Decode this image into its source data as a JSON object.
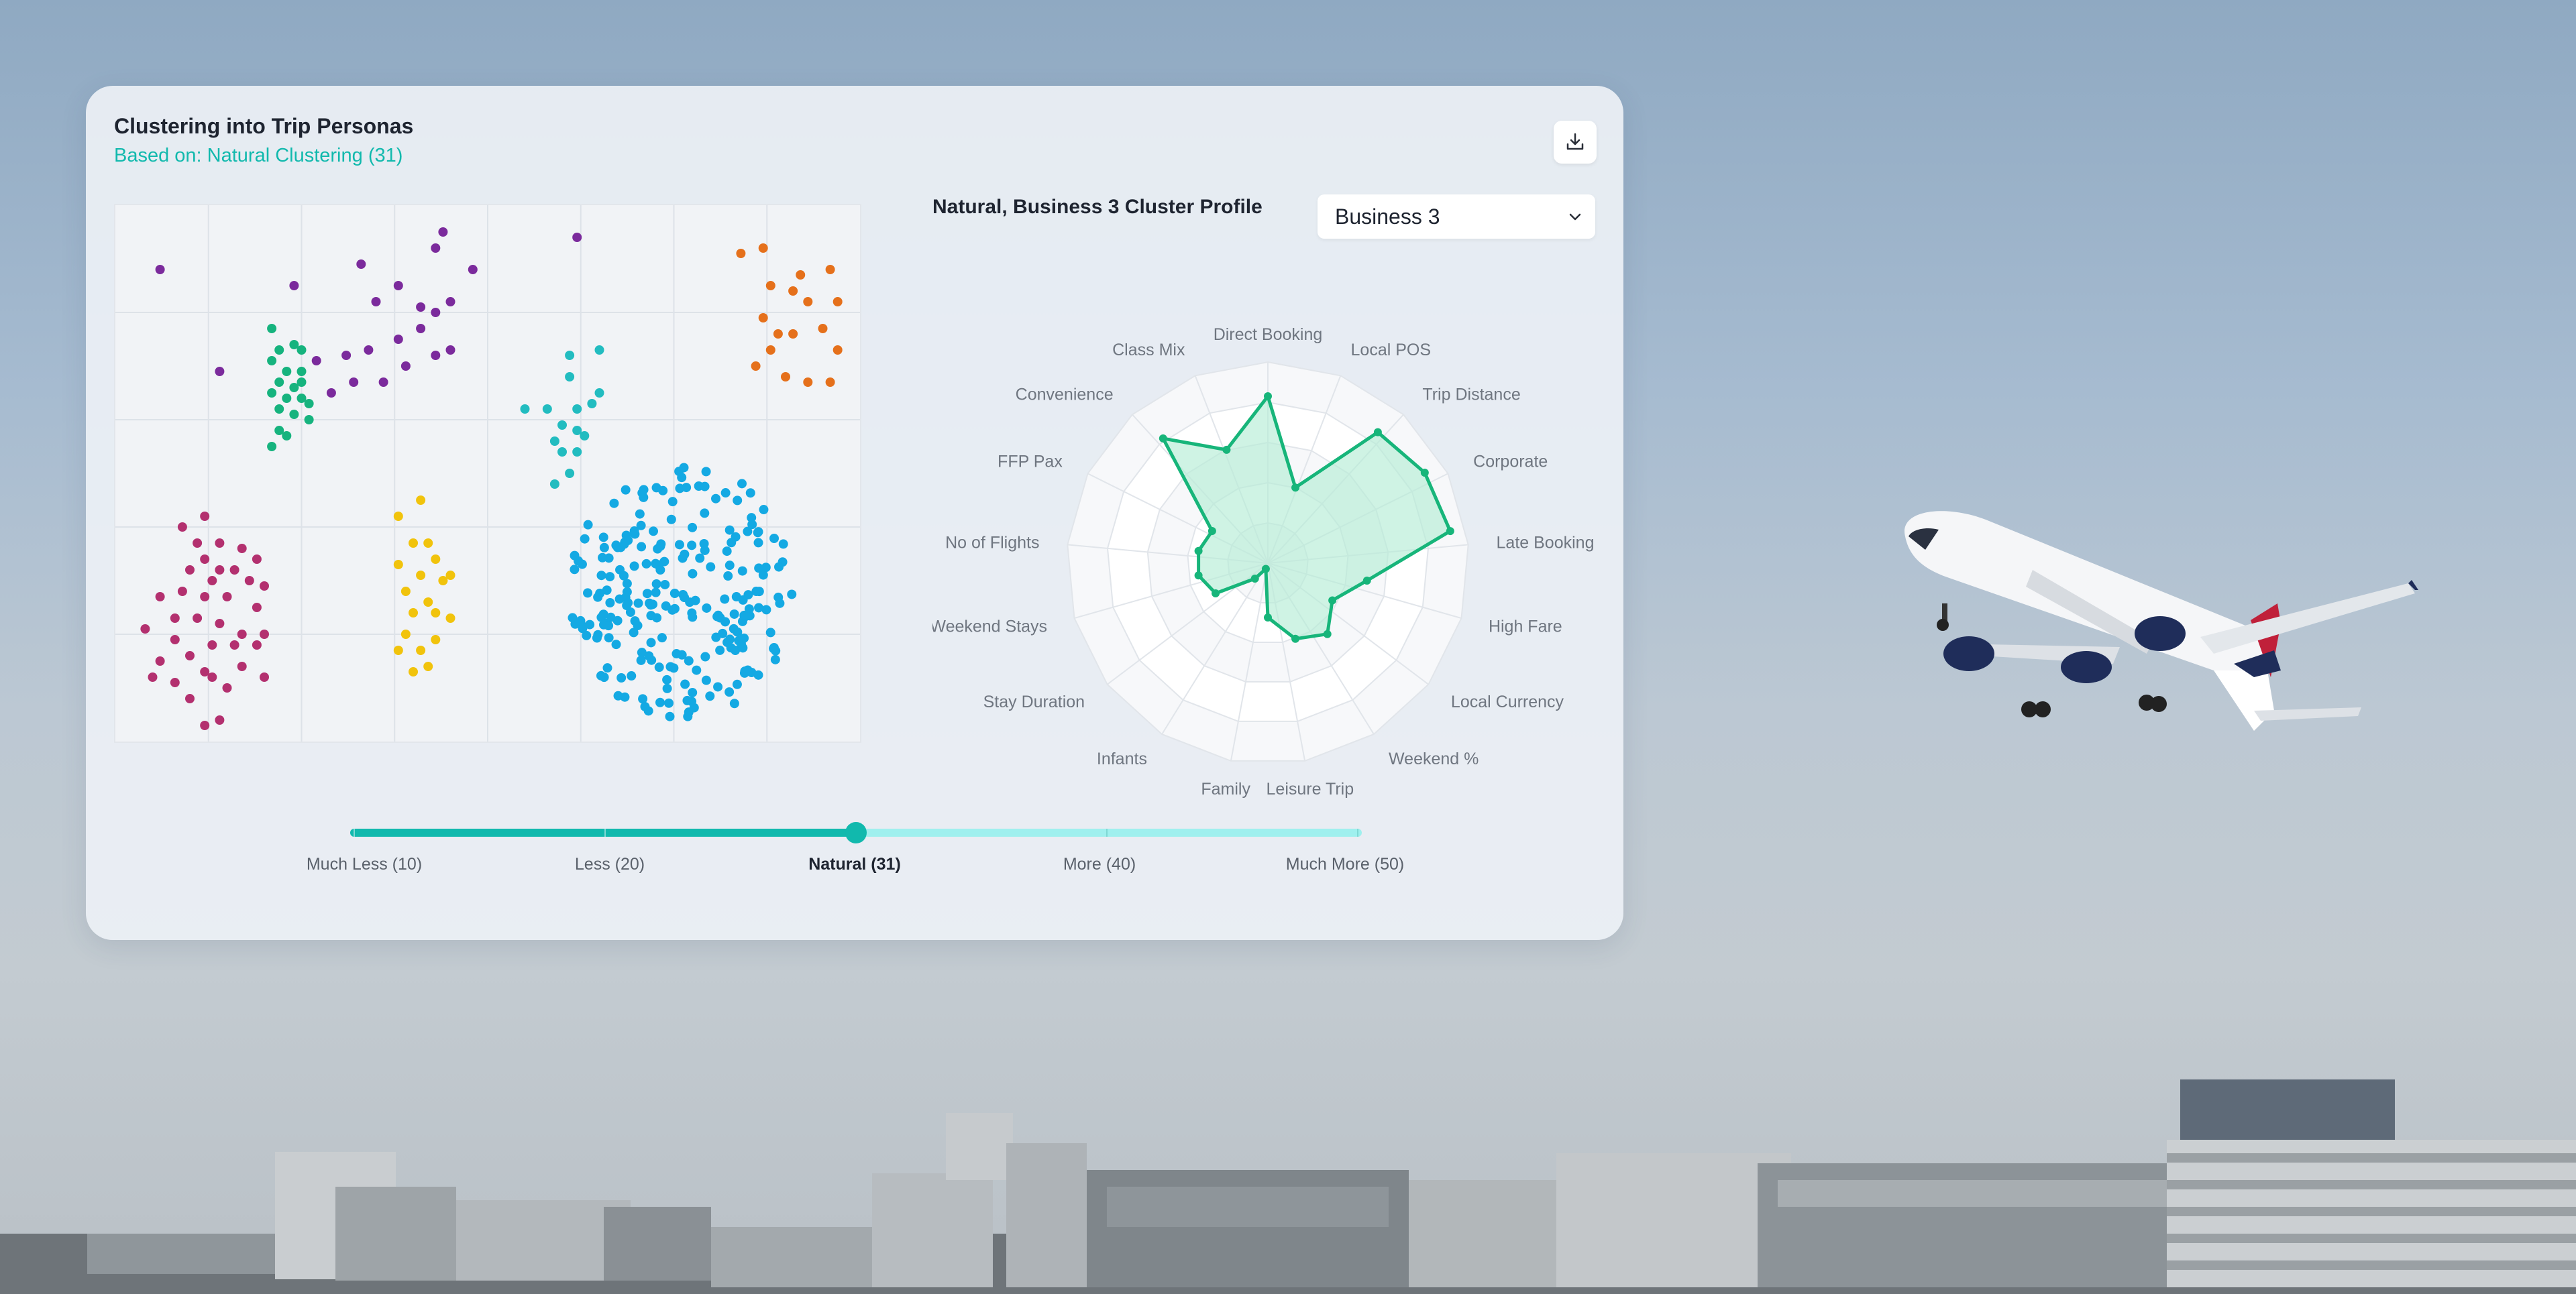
{
  "card": {
    "title": "Clustering into Trip Personas",
    "subtitle": "Based on: Natural Clustering (31)"
  },
  "icons": {
    "download": "download-icon",
    "dropdown": "chevron-down-icon"
  },
  "radar": {
    "title": "Natural, Business 3 Cluster Profile",
    "selected_cluster": "Business 3"
  },
  "colors": {
    "accent": "#11b9ad",
    "radar_line": "#17b57a",
    "radar_fill": "#b6ecd6",
    "cluster_purple": "#7b2a9c",
    "cluster_green": "#16b37e",
    "cluster_orange": "#e5701b",
    "cluster_teal": "#22bcc0",
    "cluster_blue": "#14a9e3",
    "cluster_magenta": "#b3306f",
    "cluster_yellow": "#f1c30c"
  },
  "chart_data": [
    {
      "type": "scatter",
      "clusters": [
        {
          "color": "#7b2a9c",
          "points": [
            [
              0.06,
              0.12
            ],
            [
              0.24,
              0.15
            ],
            [
              0.33,
              0.11
            ],
            [
              0.38,
              0.15
            ],
            [
              0.43,
              0.08
            ],
            [
              0.45,
              0.18
            ],
            [
              0.35,
              0.18
            ],
            [
              0.41,
              0.19
            ],
            [
              0.48,
              0.12
            ],
            [
              0.43,
              0.2
            ],
            [
              0.38,
              0.25
            ],
            [
              0.34,
              0.27
            ],
            [
              0.31,
              0.28
            ],
            [
              0.36,
              0.33
            ],
            [
              0.29,
              0.35
            ],
            [
              0.32,
              0.33
            ],
            [
              0.39,
              0.3
            ],
            [
              0.43,
              0.28
            ],
            [
              0.45,
              0.27
            ],
            [
              0.14,
              0.31
            ],
            [
              0.27,
              0.29
            ],
            [
              0.44,
              0.05
            ],
            [
              0.62,
              0.06
            ],
            [
              0.41,
              0.23
            ]
          ]
        },
        {
          "color": "#16b37e",
          "points": [
            [
              0.21,
              0.23
            ],
            [
              0.22,
              0.27
            ],
            [
              0.24,
              0.26
            ],
            [
              0.25,
              0.27
            ],
            [
              0.21,
              0.29
            ],
            [
              0.23,
              0.31
            ],
            [
              0.25,
              0.31
            ],
            [
              0.22,
              0.33
            ],
            [
              0.24,
              0.34
            ],
            [
              0.21,
              0.35
            ],
            [
              0.23,
              0.36
            ],
            [
              0.25,
              0.36
            ],
            [
              0.26,
              0.37
            ],
            [
              0.22,
              0.38
            ],
            [
              0.24,
              0.39
            ],
            [
              0.26,
              0.4
            ],
            [
              0.22,
              0.42
            ],
            [
              0.21,
              0.45
            ],
            [
              0.23,
              0.43
            ],
            [
              0.25,
              0.33
            ]
          ]
        },
        {
          "color": "#e5701b",
          "points": [
            [
              0.84,
              0.09
            ],
            [
              0.87,
              0.08
            ],
            [
              0.92,
              0.13
            ],
            [
              0.96,
              0.12
            ],
            [
              0.88,
              0.15
            ],
            [
              0.91,
              0.16
            ],
            [
              0.93,
              0.18
            ],
            [
              0.97,
              0.18
            ],
            [
              0.87,
              0.21
            ],
            [
              0.89,
              0.24
            ],
            [
              0.91,
              0.24
            ],
            [
              0.95,
              0.23
            ],
            [
              0.97,
              0.27
            ],
            [
              0.86,
              0.3
            ],
            [
              0.9,
              0.32
            ],
            [
              0.93,
              0.33
            ],
            [
              0.96,
              0.33
            ],
            [
              0.88,
              0.27
            ]
          ]
        },
        {
          "color": "#22bcc0",
          "points": [
            [
              0.61,
              0.28
            ],
            [
              0.65,
              0.27
            ],
            [
              0.61,
              0.32
            ],
            [
              0.65,
              0.35
            ],
            [
              0.58,
              0.38
            ],
            [
              0.62,
              0.38
            ],
            [
              0.64,
              0.37
            ],
            [
              0.6,
              0.41
            ],
            [
              0.62,
              0.42
            ],
            [
              0.59,
              0.44
            ],
            [
              0.63,
              0.43
            ],
            [
              0.6,
              0.46
            ],
            [
              0.59,
              0.52
            ],
            [
              0.61,
              0.5
            ],
            [
              0.62,
              0.46
            ],
            [
              0.55,
              0.38
            ]
          ]
        },
        {
          "color": "#b3306f",
          "points": [
            [
              0.09,
              0.6
            ],
            [
              0.12,
              0.58
            ],
            [
              0.12,
              0.66
            ],
            [
              0.14,
              0.63
            ],
            [
              0.17,
              0.64
            ],
            [
              0.1,
              0.68
            ],
            [
              0.13,
              0.7
            ],
            [
              0.16,
              0.68
            ],
            [
              0.18,
              0.7
            ],
            [
              0.06,
              0.73
            ],
            [
              0.09,
              0.72
            ],
            [
              0.12,
              0.73
            ],
            [
              0.15,
              0.73
            ],
            [
              0.19,
              0.75
            ],
            [
              0.2,
              0.71
            ],
            [
              0.08,
              0.77
            ],
            [
              0.11,
              0.77
            ],
            [
              0.14,
              0.78
            ],
            [
              0.17,
              0.8
            ],
            [
              0.2,
              0.8
            ],
            [
              0.04,
              0.79
            ],
            [
              0.08,
              0.81
            ],
            [
              0.13,
              0.82
            ],
            [
              0.16,
              0.82
            ],
            [
              0.19,
              0.82
            ],
            [
              0.06,
              0.85
            ],
            [
              0.1,
              0.84
            ],
            [
              0.12,
              0.87
            ],
            [
              0.17,
              0.86
            ],
            [
              0.08,
              0.89
            ],
            [
              0.1,
              0.92
            ],
            [
              0.13,
              0.88
            ],
            [
              0.15,
              0.9
            ],
            [
              0.14,
              0.96
            ],
            [
              0.12,
              0.97
            ],
            [
              0.2,
              0.88
            ],
            [
              0.05,
              0.88
            ],
            [
              0.14,
              0.68
            ],
            [
              0.11,
              0.63
            ],
            [
              0.19,
              0.66
            ]
          ]
        },
        {
          "color": "#f1c30c",
          "points": [
            [
              0.41,
              0.55
            ],
            [
              0.38,
              0.58
            ],
            [
              0.4,
              0.63
            ],
            [
              0.42,
              0.63
            ],
            [
              0.43,
              0.66
            ],
            [
              0.38,
              0.67
            ],
            [
              0.41,
              0.69
            ],
            [
              0.44,
              0.7
            ],
            [
              0.45,
              0.69
            ],
            [
              0.39,
              0.72
            ],
            [
              0.42,
              0.74
            ],
            [
              0.4,
              0.76
            ],
            [
              0.43,
              0.76
            ],
            [
              0.45,
              0.77
            ],
            [
              0.39,
              0.8
            ],
            [
              0.41,
              0.83
            ],
            [
              0.42,
              0.86
            ],
            [
              0.4,
              0.87
            ],
            [
              0.38,
              0.83
            ],
            [
              0.43,
              0.81
            ]
          ]
        }
      ],
      "big_cluster": {
        "color": "#14a9e3",
        "center": [
          0.76,
          0.72
        ],
        "rx": 0.15,
        "ry": 0.24,
        "count": 230,
        "seed": 7
      }
    },
    {
      "type": "radar",
      "axes": [
        "Direct Booking",
        "Local POS",
        "Trip Distance",
        "Corporate",
        "Late Booking",
        "High Fare",
        "Local Currency",
        "Weekend %",
        "Leisure Trip",
        "Family",
        "Infants",
        "Stay Duration",
        "Weekend Stays",
        "No of Flights",
        "FFP Pax",
        "Convenience",
        "Class Mix"
      ],
      "values": [
        0.83,
        0.4,
        0.85,
        0.9,
        0.92,
        0.5,
        0.37,
        0.46,
        0.4,
        0.27,
        0.03,
        0.1,
        0.3,
        0.35,
        0.35,
        0.32,
        0.81,
        0.6
      ],
      "rings": 5
    }
  ],
  "slider": {
    "stops": [
      "Much Less (10)",
      "Less (20)",
      "Natural (31)",
      "More (40)",
      "Much More (50)"
    ],
    "selected_index": 2
  }
}
